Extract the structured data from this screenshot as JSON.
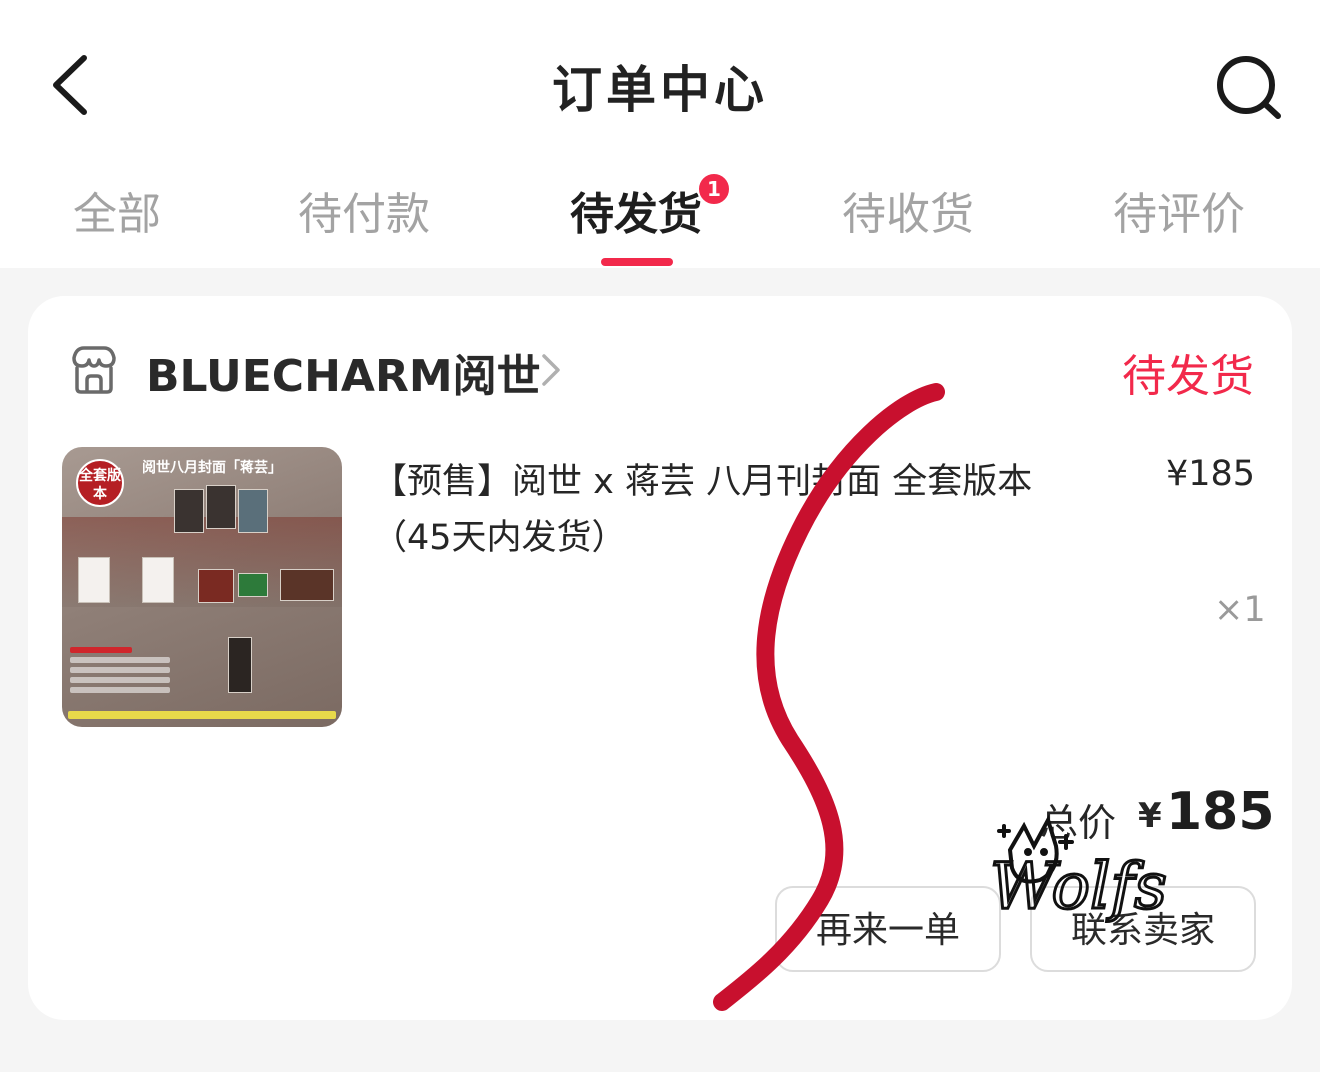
{
  "header": {
    "title": "订单中心",
    "back_icon": "chevron-left-icon",
    "search_icon": "search-icon"
  },
  "tabs": [
    {
      "label": "全部"
    },
    {
      "label": "待付款"
    },
    {
      "label": "待发货",
      "active": true,
      "badge": "1"
    },
    {
      "label": "待收货"
    },
    {
      "label": "待评价"
    }
  ],
  "order": {
    "shop_icon": "store-icon",
    "shop_name": "BLUECHARM阅世",
    "status": "待发货",
    "product": {
      "title": "【预售】阅世 x 蒋芸 八月刊封面 全套版本（45天内发货）",
      "price": "¥185",
      "quantity": "×1",
      "thumbnail": {
        "title": "阅世八月封面「蒋芸」",
        "badge": "全套版本"
      }
    },
    "total": {
      "label": "总价",
      "currency": "¥",
      "value": "185"
    },
    "actions": {
      "reorder_label": "再来一单",
      "contact_label": "联系卖家"
    }
  },
  "overlay": {
    "doodle_text": "Wolfs",
    "stroke_color": "#c8102e"
  },
  "colors": {
    "accent": "#f2294b",
    "text": "#262626",
    "muted": "#a3a3a3",
    "background": "#f5f5f5"
  }
}
